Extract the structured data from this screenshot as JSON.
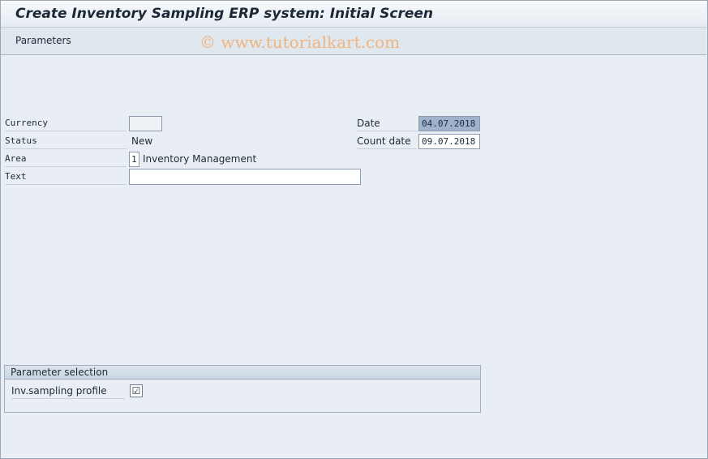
{
  "window": {
    "title": "Create Inventory Sampling ERP system: Initial Screen",
    "watermark": "© www.tutorialkart.com"
  },
  "toolbar": {
    "parameters_label": "Parameters"
  },
  "form": {
    "currency": {
      "label": "Currency",
      "value": ""
    },
    "status": {
      "label": "Status",
      "value": "New"
    },
    "area": {
      "label": "Area",
      "code": "1",
      "description": "Inventory Management"
    },
    "text": {
      "label": "Text",
      "value": ""
    },
    "date": {
      "label": "Date",
      "value": "04.07.2018"
    },
    "count_date": {
      "label": "Count date",
      "value": "09.07.2018"
    }
  },
  "parameter_selection": {
    "title": "Parameter selection",
    "profile_label": "Inv.sampling profile",
    "profile_checked": true,
    "check_glyph": "☑"
  }
}
